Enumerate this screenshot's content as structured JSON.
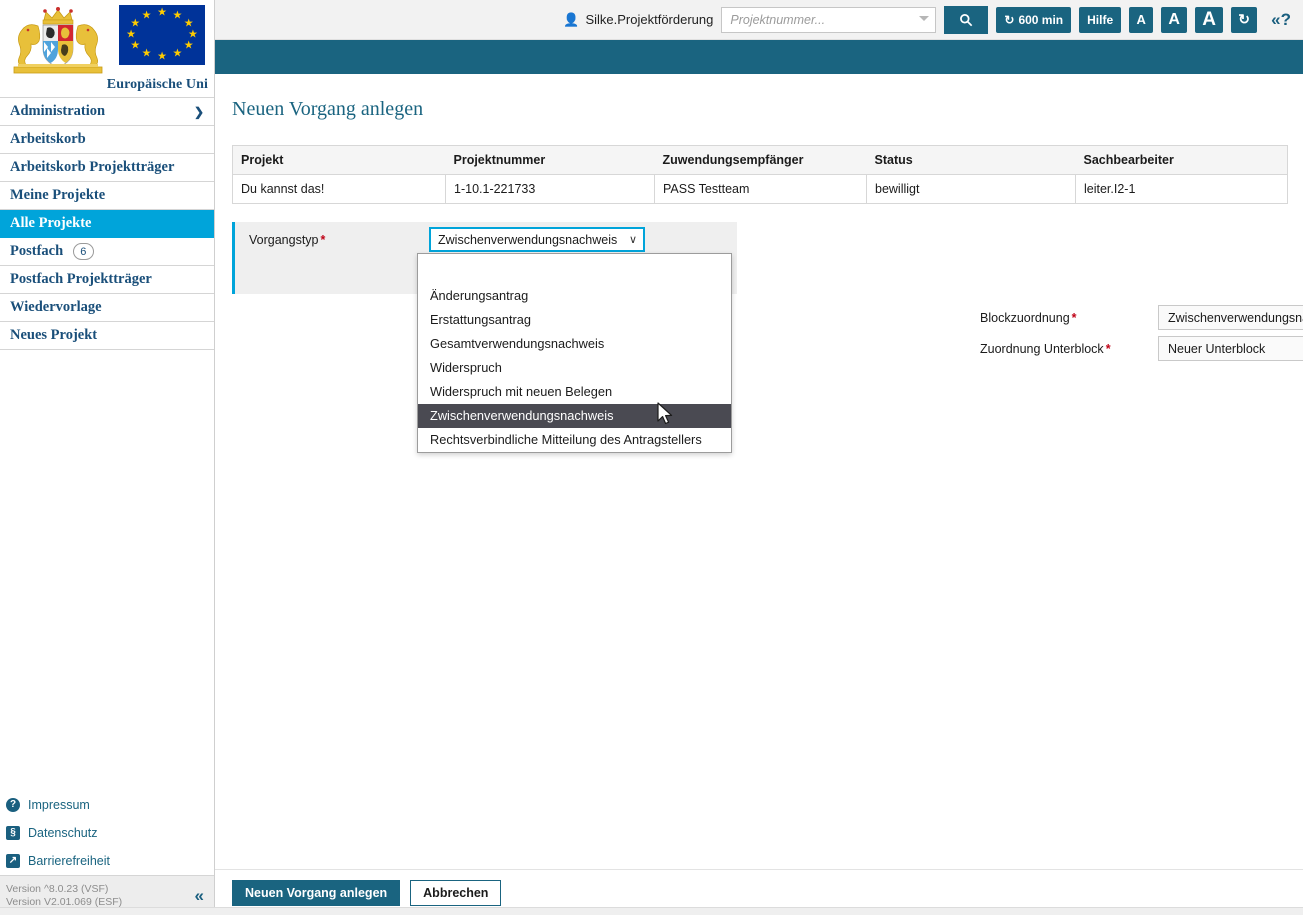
{
  "branding": {
    "crest_alt": "bavaria-coat-of-arms",
    "eu_flag_alt": "european-union-flag",
    "eu_caption": "Europäische Uni"
  },
  "sidebar": {
    "items": [
      {
        "label": "Administration",
        "chevron": "❯",
        "active": false
      },
      {
        "label": "Arbeitskorb",
        "active": false
      },
      {
        "label": "Arbeitskorb Projektträger",
        "active": false
      },
      {
        "label": "Meine Projekte",
        "active": false
      },
      {
        "label": "Alle Projekte",
        "active": true
      },
      {
        "label": "Postfach",
        "badge": "6",
        "active": false
      },
      {
        "label": "Postfach Projektträger",
        "active": false
      },
      {
        "label": "Wiedervorlage",
        "active": false
      },
      {
        "label": "Neues Projekt",
        "active": false
      }
    ],
    "links": [
      {
        "label": "Impressum",
        "icon": "?",
        "icon_name": "question-circle-icon"
      },
      {
        "label": "Datenschutz",
        "icon": "§",
        "icon_name": "privacy-icon"
      },
      {
        "label": "Barrierefreiheit",
        "icon": "↗",
        "icon_name": "accessibility-icon"
      }
    ],
    "version_line1": "Version ^8.0.23 (VSF)",
    "version_line2": "Version V2.01.069 (ESF)",
    "collapse_icon": "«"
  },
  "topbar": {
    "user_name": "Silke.Projektförderung",
    "user_icon": "👤",
    "search_placeholder": "Projektnummer...",
    "search_value": "",
    "search_button_icon": "🔍",
    "session_timer": "600 min",
    "session_icon": "↻",
    "help_label": "Hilfe",
    "font_small": "A",
    "font_medium": "A",
    "font_large": "A",
    "refresh_icon": "↻",
    "help_toggle": "«?"
  },
  "main": {
    "page_title": "Neuen Vorgang anlegen",
    "table": {
      "headers": [
        "Projekt",
        "Projektnummer",
        "Zuwendungsempfänger",
        "Status",
        "Sachbearbeiter"
      ],
      "rows": [
        [
          "Du kannst das!",
          "1-10.1-221733",
          "PASS Testteam",
          "bewilligt",
          "leiter.I2-1"
        ]
      ]
    },
    "vorgangstyp": {
      "label": "Vorgangstyp",
      "required_marker": "*",
      "selected": "Zwischenverwendungsnachweis",
      "chevron": "∨",
      "options": [
        "",
        "Änderungsantrag",
        "Erstattungsantrag",
        "Gesamtverwendungsnachweis",
        "Widerspruch",
        "Widerspruch mit neuen Belegen",
        "Zwischenverwendungsnachweis",
        "Rechtsverbindliche Mitteilung des Antragstellers"
      ],
      "highlighted_option": "Zwischenverwendungsnachweis"
    },
    "blockzuordnung": {
      "label": "Blockzuordnung",
      "required_marker": "*",
      "value": "Zwischenverwendungsnachweis",
      "chevron": "∨"
    },
    "unterblock": {
      "label": "Zuordnung Unterblock",
      "required_marker": "*",
      "value": "Neuer Unterblock",
      "chevron": "∨"
    }
  },
  "footer": {
    "submit_label": "Neuen Vorgang anlegen",
    "cancel_label": "Abbrechen"
  },
  "colors": {
    "teal": "#1a6480",
    "cyan_accent": "#00a4da",
    "required_red": "#c00418",
    "highlight_gray": "#4a4a52",
    "eu_blue": "#003399",
    "eu_star": "#FFCC00"
  }
}
